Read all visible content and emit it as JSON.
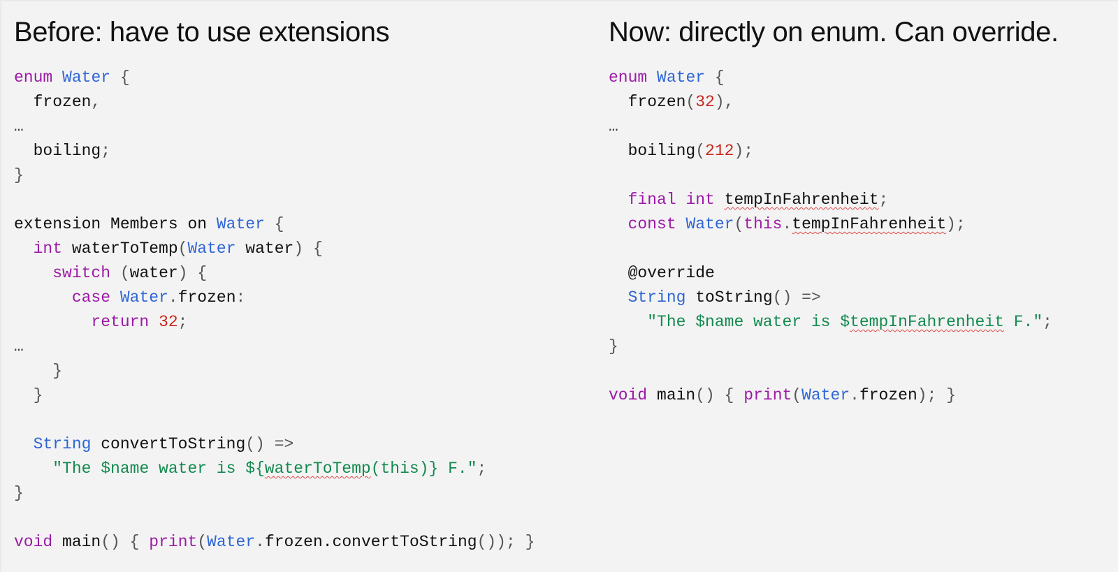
{
  "colors": {
    "background": "#f3f3f3",
    "keyword": "#9c1aa6",
    "type": "#2f66d4",
    "number": "#c8261c",
    "string": "#128a4f",
    "punctuation": "#555555",
    "plain": "#111111"
  },
  "left": {
    "title": "Before: have to use extensions",
    "lines": [
      [
        [
          "keyword",
          "enum"
        ],
        [
          "plain",
          " "
        ],
        [
          "type",
          "Water"
        ],
        [
          "plain",
          " "
        ],
        [
          "punct",
          "{"
        ]
      ],
      [
        [
          "plain",
          "  frozen"
        ],
        [
          "punct",
          ","
        ]
      ],
      [
        [
          "ellipsis",
          "…"
        ]
      ],
      [
        [
          "plain",
          "  boiling"
        ],
        [
          "punct",
          ";"
        ]
      ],
      [
        [
          "punct",
          "}"
        ]
      ],
      [],
      [
        [
          "plain",
          "extension Members on "
        ],
        [
          "type",
          "Water"
        ],
        [
          "plain",
          " "
        ],
        [
          "punct",
          "{"
        ]
      ],
      [
        [
          "plain",
          "  "
        ],
        [
          "keyword",
          "int"
        ],
        [
          "plain",
          " waterToTemp"
        ],
        [
          "punct",
          "("
        ],
        [
          "type",
          "Water"
        ],
        [
          "plain",
          " water"
        ],
        [
          "punct",
          ")"
        ],
        [
          "plain",
          " "
        ],
        [
          "punct",
          "{"
        ]
      ],
      [
        [
          "plain",
          "    "
        ],
        [
          "keyword",
          "switch"
        ],
        [
          "plain",
          " "
        ],
        [
          "punct",
          "("
        ],
        [
          "plain",
          "water"
        ],
        [
          "punct",
          ")"
        ],
        [
          "plain",
          " "
        ],
        [
          "punct",
          "{"
        ]
      ],
      [
        [
          "plain",
          "      "
        ],
        [
          "keyword",
          "case"
        ],
        [
          "plain",
          " "
        ],
        [
          "type",
          "Water"
        ],
        [
          "punct",
          "."
        ],
        [
          "plain",
          "frozen"
        ],
        [
          "punct",
          ":"
        ]
      ],
      [
        [
          "plain",
          "        "
        ],
        [
          "keyword",
          "return"
        ],
        [
          "plain",
          " "
        ],
        [
          "number",
          "32"
        ],
        [
          "punct",
          ";"
        ]
      ],
      [
        [
          "ellipsis",
          "…"
        ]
      ],
      [
        [
          "plain",
          "    "
        ],
        [
          "punct",
          "}"
        ]
      ],
      [
        [
          "plain",
          "  "
        ],
        [
          "punct",
          "}"
        ]
      ],
      [],
      [
        [
          "plain",
          "  "
        ],
        [
          "type",
          "String"
        ],
        [
          "plain",
          " convertToString"
        ],
        [
          "punct",
          "()"
        ],
        [
          "plain",
          " "
        ],
        [
          "punct",
          "=>"
        ]
      ],
      [
        [
          "plain",
          "    "
        ],
        [
          "string",
          "\"The $name water is ${"
        ],
        [
          "string-squiggle",
          "waterToTemp"
        ],
        [
          "string",
          "(this)} F.\""
        ],
        [
          "punct",
          ";"
        ]
      ],
      [
        [
          "punct",
          "}"
        ]
      ],
      [],
      [
        [
          "keyword",
          "void"
        ],
        [
          "plain",
          " main"
        ],
        [
          "punct",
          "()"
        ],
        [
          "plain",
          " "
        ],
        [
          "punct",
          "{"
        ],
        [
          "plain",
          " "
        ],
        [
          "keyword",
          "print"
        ],
        [
          "punct",
          "("
        ],
        [
          "type",
          "Water"
        ],
        [
          "punct",
          "."
        ],
        [
          "plain",
          "frozen.convertToString"
        ],
        [
          "punct",
          "());"
        ],
        [
          "plain",
          " "
        ],
        [
          "punct",
          "}"
        ]
      ]
    ]
  },
  "right": {
    "title": "Now: directly on enum. Can override.",
    "lines": [
      [
        [
          "keyword",
          "enum"
        ],
        [
          "plain",
          " "
        ],
        [
          "type",
          "Water"
        ],
        [
          "plain",
          " "
        ],
        [
          "punct",
          "{"
        ]
      ],
      [
        [
          "plain",
          "  frozen"
        ],
        [
          "punct",
          "("
        ],
        [
          "number",
          "32"
        ],
        [
          "punct",
          "),"
        ]
      ],
      [
        [
          "ellipsis",
          "…"
        ]
      ],
      [
        [
          "plain",
          "  boiling"
        ],
        [
          "punct",
          "("
        ],
        [
          "number",
          "212"
        ],
        [
          "punct",
          ");"
        ]
      ],
      [],
      [
        [
          "plain",
          "  "
        ],
        [
          "keyword",
          "final"
        ],
        [
          "plain",
          " "
        ],
        [
          "keyword",
          "int"
        ],
        [
          "plain",
          " "
        ],
        [
          "plain-squiggle",
          "tempInFahrenheit"
        ],
        [
          "punct",
          ";"
        ]
      ],
      [
        [
          "plain",
          "  "
        ],
        [
          "keyword",
          "const"
        ],
        [
          "plain",
          " "
        ],
        [
          "type",
          "Water"
        ],
        [
          "punct",
          "("
        ],
        [
          "keyword",
          "this"
        ],
        [
          "punct",
          "."
        ],
        [
          "plain-squiggle",
          "tempInFahrenheit"
        ],
        [
          "punct",
          ");"
        ]
      ],
      [],
      [
        [
          "plain",
          "  @override"
        ]
      ],
      [
        [
          "plain",
          "  "
        ],
        [
          "type",
          "String"
        ],
        [
          "plain",
          " toString"
        ],
        [
          "punct",
          "()"
        ],
        [
          "plain",
          " "
        ],
        [
          "punct",
          "=>"
        ]
      ],
      [
        [
          "plain",
          "    "
        ],
        [
          "string",
          "\"The $name water is $"
        ],
        [
          "string-squiggle",
          "tempInFahrenheit"
        ],
        [
          "string",
          " F.\""
        ],
        [
          "punct",
          ";"
        ]
      ],
      [
        [
          "punct",
          "}"
        ]
      ],
      [],
      [
        [
          "keyword",
          "void"
        ],
        [
          "plain",
          " main"
        ],
        [
          "punct",
          "()"
        ],
        [
          "plain",
          " "
        ],
        [
          "punct",
          "{"
        ],
        [
          "plain",
          " "
        ],
        [
          "keyword",
          "print"
        ],
        [
          "punct",
          "("
        ],
        [
          "type",
          "Water"
        ],
        [
          "punct",
          "."
        ],
        [
          "plain",
          "frozen"
        ],
        [
          "punct",
          ");"
        ],
        [
          "plain",
          " "
        ],
        [
          "punct",
          "}"
        ]
      ]
    ]
  }
}
